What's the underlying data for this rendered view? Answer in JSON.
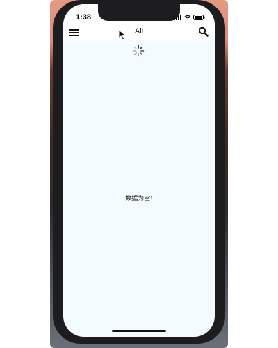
{
  "status_bar": {
    "time": "1:38",
    "icons": [
      "signal-icon",
      "wifi-icon",
      "battery-icon"
    ]
  },
  "nav_bar": {
    "title": "All",
    "left_icon": "list-icon",
    "right_icon": "search-icon"
  },
  "content": {
    "loading": true,
    "empty_message": "数据为空!"
  },
  "colors": {
    "screen_background": "#f3fbfe",
    "bar_background": "#ffffff",
    "device_frame": "#1d1d1f"
  }
}
